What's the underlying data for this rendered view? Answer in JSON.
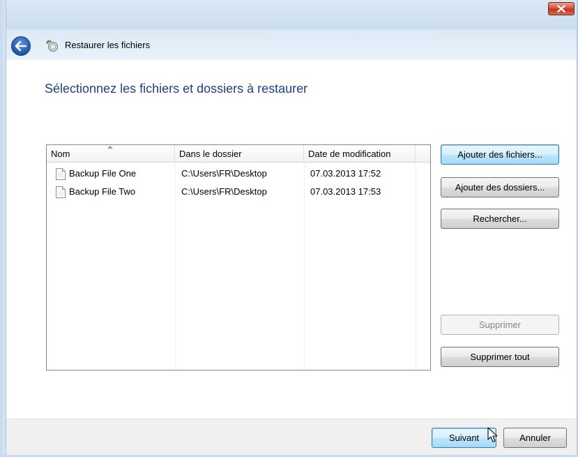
{
  "window": {
    "title": "Restaurer les fichiers"
  },
  "page": {
    "heading": "Sélectionnez les fichiers et dossiers à restaurer"
  },
  "file_list": {
    "columns": [
      "Nom",
      "Dans le dossier",
      "Date de modification"
    ],
    "sorted_column": "Nom",
    "rows": [
      {
        "name": "Backup File One",
        "folder": "C:\\Users\\FR\\Desktop",
        "modified": "07.03.2013 17:52"
      },
      {
        "name": "Backup File Two",
        "folder": "C:\\Users\\FR\\Desktop",
        "modified": "07.03.2013 17:53"
      }
    ]
  },
  "side_buttons": {
    "add_files": "Ajouter des fichiers...",
    "add_folders": "Ajouter des dossiers...",
    "search": "Rechercher...",
    "remove": "Supprimer",
    "remove_all": "Supprimer tout"
  },
  "footer": {
    "next": "Suivant",
    "cancel": "Annuler"
  },
  "icons": {
    "close": "close-icon",
    "back": "back-arrow-icon",
    "app": "restore-files-icon",
    "file": "file-icon",
    "cursor": "mouse-pointer-icon"
  },
  "colors": {
    "heading": "#1e3f8c",
    "close_button": "#c0331d",
    "focused_button": "#3c7fb1"
  }
}
